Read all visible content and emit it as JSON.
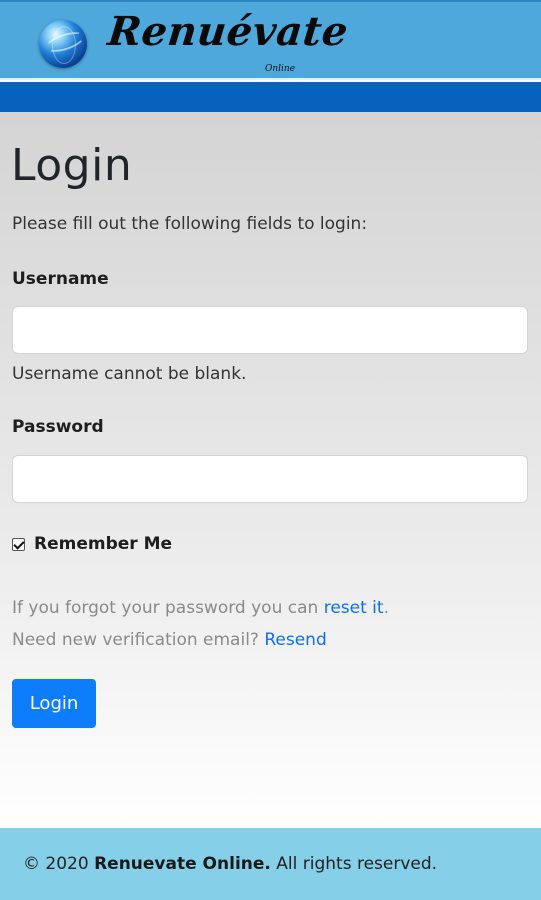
{
  "header": {
    "brand": "Renuévate",
    "brand_sub": "Online",
    "colors": {
      "topbar": "#4ea8dc",
      "navbar": "#0662bd"
    }
  },
  "login": {
    "title": "Login",
    "intro": "Please fill out the following fields to login:",
    "username_label": "Username",
    "username_value": "",
    "username_error": "Username cannot be blank.",
    "password_label": "Password",
    "password_value": "",
    "remember_label": "Remember Me",
    "remember_checked": true,
    "forgot_text": "If you forgot your password you can ",
    "forgot_link": "reset it",
    "forgot_end": ".",
    "resend_text": "Need new verification email? ",
    "resend_link": "Resend",
    "submit_label": "Login"
  },
  "footer": {
    "prefix": "© 2020 ",
    "brand": "Renuevate Online.",
    "suffix": " All rights reserved."
  }
}
